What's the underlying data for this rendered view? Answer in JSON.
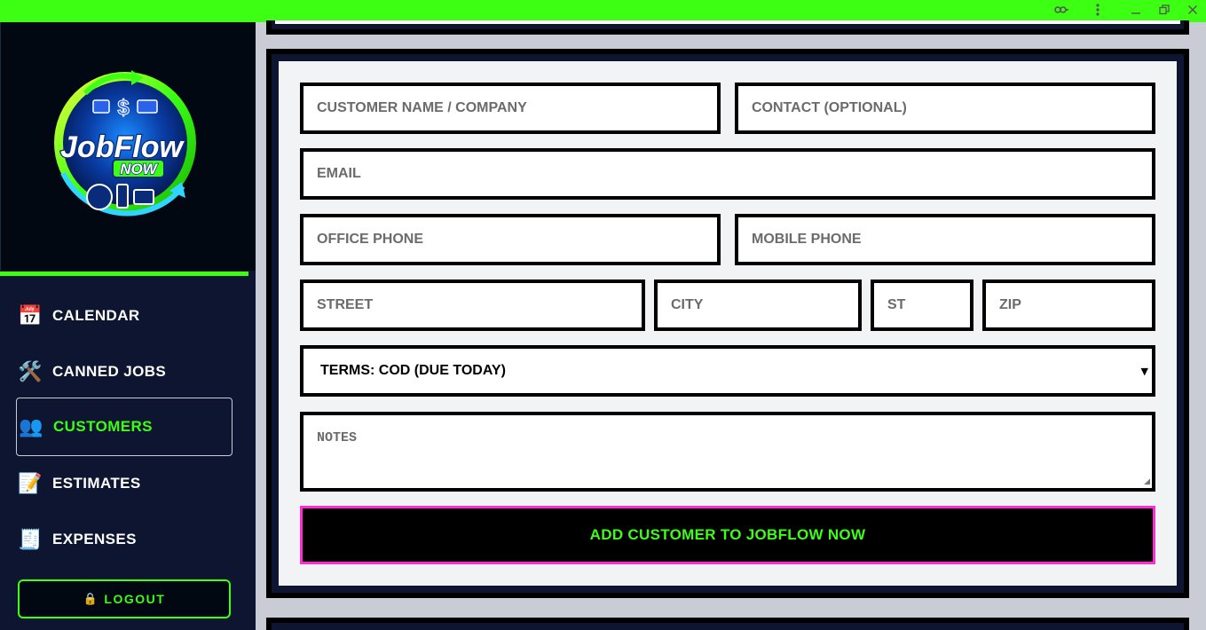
{
  "titlebar": {
    "color": "#3cff14",
    "icons": [
      "key-icon",
      "kebab-menu-icon",
      "minimize-icon",
      "restore-icon",
      "close-icon"
    ]
  },
  "sidebar": {
    "logo": {
      "line1": "JobFlow",
      "line2": "NOW"
    },
    "items": [
      {
        "icon": "calendar-icon",
        "glyph": "📅",
        "label": "CALENDAR"
      },
      {
        "icon": "tools-icon",
        "glyph": "🛠️",
        "label": "CANNED JOBS"
      },
      {
        "icon": "people-icon",
        "glyph": "👥",
        "label": "CUSTOMERS",
        "active": true
      },
      {
        "icon": "memo-icon",
        "glyph": "📝",
        "label": "ESTIMATES"
      },
      {
        "icon": "receipt-icon",
        "glyph": "🧾",
        "label": "EXPENSES"
      }
    ],
    "logout": {
      "icon": "🔒",
      "label": "LOGOUT"
    }
  },
  "form": {
    "customer_name": {
      "placeholder": "CUSTOMER NAME / COMPANY",
      "value": ""
    },
    "contact": {
      "placeholder": "CONTACT (OPTIONAL)",
      "value": ""
    },
    "email": {
      "placeholder": "EMAIL",
      "value": ""
    },
    "office_phone": {
      "placeholder": "OFFICE PHONE",
      "value": ""
    },
    "mobile_phone": {
      "placeholder": "MOBILE PHONE",
      "value": ""
    },
    "street": {
      "placeholder": "STREET",
      "value": ""
    },
    "city": {
      "placeholder": "CITY",
      "value": ""
    },
    "state": {
      "placeholder": "ST",
      "value": ""
    },
    "zip": {
      "placeholder": "ZIP",
      "value": ""
    },
    "terms": {
      "selected": "TERMS: COD (DUE TODAY)"
    },
    "notes": {
      "placeholder": "NOTES",
      "value": ""
    },
    "submit_label": "ADD CUSTOMER TO JOBFLOW NOW"
  },
  "colors": {
    "accent_green": "#3cff14",
    "accent_pink": "#ff2bd6",
    "sidebar_bg": "#0d1530",
    "panel_bg": "#f2f3f5"
  }
}
